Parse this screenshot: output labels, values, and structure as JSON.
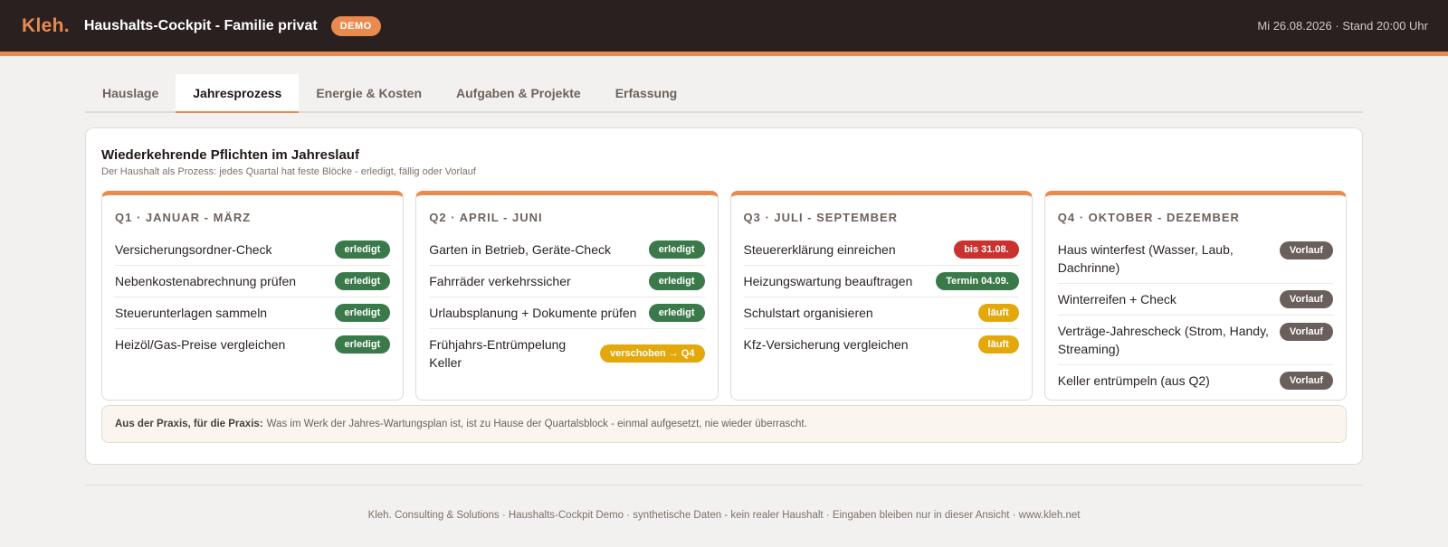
{
  "header": {
    "brand": "Kleh.",
    "title": "Haushalts-Cockpit - Familie privat",
    "demo_badge": "DEMO",
    "timestamp": "Mi 26.08.2026 · Stand 20:00 Uhr"
  },
  "tabs": [
    {
      "label": "Hauslage",
      "active": false
    },
    {
      "label": "Jahresprozess",
      "active": true
    },
    {
      "label": "Energie & Kosten",
      "active": false
    },
    {
      "label": "Aufgaben & Projekte",
      "active": false
    },
    {
      "label": "Erfassung",
      "active": false
    }
  ],
  "panel": {
    "title": "Wiederkehrende Pflichten im Jahreslauf",
    "subtitle": "Der Haushalt als Prozess: jedes Quartal hat feste Blöcke - erledigt, fällig oder Vorlauf"
  },
  "quarters": [
    {
      "title": "Q1 · JANUAR - MÄRZ",
      "items": [
        {
          "text": "Versicherungsordner-Check",
          "badge": "erledigt"
        },
        {
          "text": "Nebenkostenabrechnung prüfen",
          "badge": "erledigt"
        },
        {
          "text": "Steuerunterlagen sammeln",
          "badge": "erledigt"
        },
        {
          "text": "Heizöl/Gas-Preise vergleichen",
          "badge": "erledigt"
        }
      ]
    },
    {
      "title": "Q2 · APRIL - JUNI",
      "items": [
        {
          "text": "Garten in Betrieb, Geräte-Check",
          "badge": "erledigt"
        },
        {
          "text": "Fahrräder verkehrssicher",
          "badge": "erledigt"
        },
        {
          "text": "Urlaubsplanung + Dokumente prüfen",
          "badge": "erledigt"
        },
        {
          "text": "Frühjahrs-Entrümpelung Keller",
          "badge": "verschoben → Q4"
        }
      ]
    },
    {
      "title": "Q3 · JULI - SEPTEMBER",
      "items": [
        {
          "text": "Steuererklärung einreichen",
          "badge": "bis 31.08."
        },
        {
          "text": "Heizungswartung beauftragen",
          "badge": "Termin 04.09."
        },
        {
          "text": "Schulstart organisieren",
          "badge": "läuft"
        },
        {
          "text": "Kfz-Versicherung vergleichen",
          "badge": "läuft"
        }
      ]
    },
    {
      "title": "Q4 · OKTOBER - DEZEMBER",
      "items": [
        {
          "text": "Haus winterfest (Wasser, Laub, Dachrinne)",
          "badge": "Vorlauf"
        },
        {
          "text": "Winterreifen + Check",
          "badge": "Vorlauf"
        },
        {
          "text": "Verträge-Jahrescheck (Strom, Handy, Streaming)",
          "badge": "Vorlauf"
        },
        {
          "text": "Keller entrümpeln (aus Q2)",
          "badge": "Vorlauf"
        }
      ]
    }
  ],
  "tip": {
    "label": "Aus der Praxis, für die Praxis:",
    "text": "Was im Werk der Jahres-Wartungsplan ist, ist zu Hause der Quartalsblock - einmal aufgesetzt, nie wieder überrascht."
  },
  "footer": "Kleh. Consulting & Solutions · Haushalts-Cockpit Demo · synthetische Daten - kein realer Haushalt · Eingaben bleiben nur in dieser Ansicht · www.kleh.net",
  "colors": {
    "accent": "#e98a4f",
    "header_bg": "#2a2020",
    "done": "#3a7a4a",
    "due": "#c9322f",
    "running": "#e3a80c",
    "preparation": "#6a5f5b"
  }
}
